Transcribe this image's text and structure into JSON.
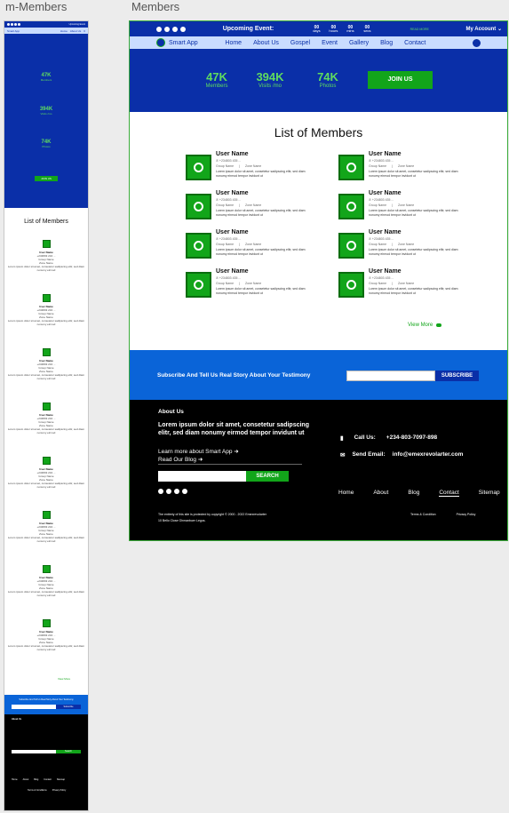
{
  "labels": {
    "mobile": "m-Members",
    "desktop": "Members"
  },
  "colors": {
    "primary": "#0a2fa8",
    "accent": "#12a51a",
    "nav_bg": "#c9dcff",
    "subscribe_bg": "#0a64d8"
  },
  "mobile": {
    "top_text": "Upcoming Event",
    "brand": "Smart App",
    "nav": [
      "Home",
      "About Us"
    ],
    "stats": [
      {
        "value": "47K",
        "label": "Members"
      },
      {
        "value": "394K",
        "label": "Visits /mo"
      },
      {
        "value": "74K",
        "label": "Photos"
      }
    ],
    "join": "JOIN US",
    "title": "List of Members",
    "card": {
      "name": "User Name",
      "phone": "+234803 234 ...",
      "group": "Group Name",
      "zone": "Zone Name",
      "desc": "Lorem ipsum dolor sit amet, consetetur sadipscing elitr, sed diam nonumy eirmod"
    },
    "view_more": "View More",
    "sub_text": "Subscribe And Tell Us Real Story About Your Testimony",
    "sub_btn": "Subscribe",
    "about": "About Us",
    "search": "Search",
    "footer_links": [
      "Home",
      "About",
      "Blog",
      "Contact",
      "Sitemap"
    ],
    "terms": [
      "Terms & Conditions",
      "Privacy Policy"
    ]
  },
  "desktop": {
    "event": "Upcoming Event:",
    "countdown": [
      {
        "n": "00",
        "u": "days"
      },
      {
        "n": "00",
        "u": "hours"
      },
      {
        "n": "00",
        "u": "mins"
      },
      {
        "n": "00",
        "u": "secs"
      }
    ],
    "read_more": "READ MORE",
    "account": "My Account ⌄",
    "brand": "Smart App",
    "nav": [
      "Home",
      "About Us",
      "Gospel",
      "Event",
      "Gallery",
      "Blog",
      "Contact"
    ],
    "stats": [
      {
        "value": "47K",
        "label": "Members"
      },
      {
        "value": "394K",
        "label": "Visits /mo"
      },
      {
        "value": "74K",
        "label": "Photos"
      }
    ],
    "join": "JOIN US",
    "title": "List of Members",
    "members": [
      {
        "name": "User Name",
        "phone": "+234803 435 ...",
        "group": "Group Name",
        "zone": "Zone Name",
        "desc": "Lorem ipsum dolor sit amet, consetetur sadipscing elitr, sed diam nonumy eirmod tempor invidunt ut"
      },
      {
        "name": "User Name",
        "phone": "+234803 435 ...",
        "group": "Group Name",
        "zone": "Zone Name",
        "desc": "Lorem ipsum dolor sit amet, consetetur sadipscing elitr, sed diam nonumy eirmod tempor invidunt ut"
      },
      {
        "name": "User Name",
        "phone": "+234803 435 ...",
        "group": "Group Name",
        "zone": "Zone Name",
        "desc": "Lorem ipsum dolor sit amet, consetetur sadipscing elitr, sed diam nonumy eirmod tempor invidunt ut"
      },
      {
        "name": "User Name",
        "phone": "+234803 435 ...",
        "group": "Group Name",
        "zone": "Zone Name",
        "desc": "Lorem ipsum dolor sit amet, consetetur sadipscing elitr, sed diam nonumy eirmod tempor invidunt ut"
      },
      {
        "name": "User Name",
        "phone": "+234803 435 ...",
        "group": "Group Name",
        "zone": "Zone Name",
        "desc": "Lorem ipsum dolor sit amet, consetetur sadipscing elitr, sed diam nonumy eirmod tempor invidunt ut"
      },
      {
        "name": "User Name",
        "phone": "+234803 435 ...",
        "group": "Group Name",
        "zone": "Zone Name",
        "desc": "Lorem ipsum dolor sit amet, consetetur sadipscing elitr, sed diam nonumy eirmod tempor invidunt ut"
      },
      {
        "name": "User Name",
        "phone": "+234803 435 ...",
        "group": "Group Name",
        "zone": "Zone Name",
        "desc": "Lorem ipsum dolor sit amet, consetetur sadipscing elitr, sed diam nonumy eirmod tempor invidunt ut"
      },
      {
        "name": "User Name",
        "phone": "+234803 435 ...",
        "group": "Group Name",
        "zone": "Zone Name",
        "desc": "Lorem ipsum dolor sit amet, consetetur sadipscing elitr, sed diam nonumy eirmod tempor invidunt ut"
      }
    ],
    "view_more": "View More",
    "subscribe_text": "Subscribe And Tell Us Real Story About Your Testimony",
    "subscribe_btn": "SUBSCRIBE",
    "about_title": "About Us",
    "about_lead": "Lorem ipsum dolor sit amet, consetetur sadipscing elitr, sed diam nonumy eirmod tempor invidunt ut",
    "learn_more": "Learn more about Smart App",
    "read_blog": "Read Our Blog",
    "search_btn": "SEARCH",
    "call_label": "Call Us:",
    "call_value": "+234-803-7097-898",
    "email_label": "Send Email:",
    "email_value": "info@emexrevolarter.com",
    "footer_links": [
      "Home",
      "About",
      "Blog",
      "Contact",
      "Sitemap"
    ],
    "copyright": "The entirety of this site is protected by copyright © 2000 - 2022 Emexrevolarter",
    "address": "10 Bello Close Ghmanbuer Legos.",
    "terms": "Terms & Condition",
    "privacy": "Privacy Policy"
  }
}
